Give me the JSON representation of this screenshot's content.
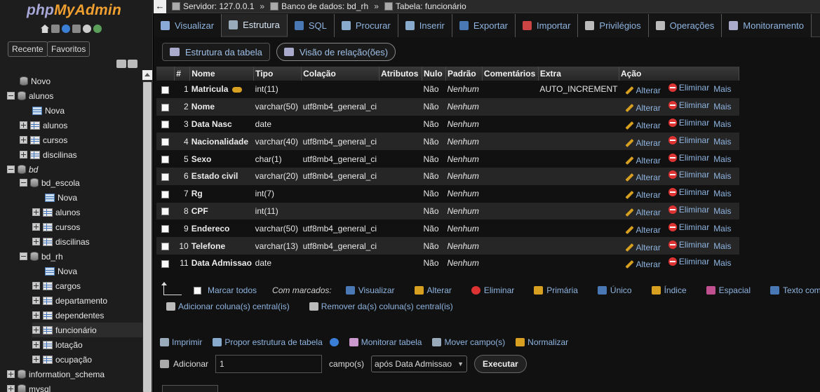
{
  "sidebar": {
    "logo_php": "php",
    "logo_myadmin": "MyAdmin",
    "recent_label": "Recente",
    "favorites_label": "Favoritos",
    "tree": [
      {
        "label": "Novo",
        "level": 0,
        "icon": "db-new"
      },
      {
        "label": "alunos",
        "level": 0,
        "icon": "db"
      },
      {
        "label": "Nova",
        "level": 1,
        "icon": "table-new"
      },
      {
        "label": "alunos",
        "level": 1,
        "icon": "table"
      },
      {
        "label": "cursos",
        "level": 1,
        "icon": "table"
      },
      {
        "label": "discilinas",
        "level": 1,
        "icon": "table"
      },
      {
        "label": "bd",
        "level": 0,
        "icon": "db"
      },
      {
        "label": "bd_escola",
        "level": 1,
        "icon": "db"
      },
      {
        "label": "Nova",
        "level": 2,
        "icon": "table-new"
      },
      {
        "label": "alunos",
        "level": 2,
        "icon": "table"
      },
      {
        "label": "cursos",
        "level": 2,
        "icon": "table"
      },
      {
        "label": "discilinas",
        "level": 2,
        "icon": "table"
      },
      {
        "label": "bd_rh",
        "level": 1,
        "icon": "db"
      },
      {
        "label": "Nova",
        "level": 2,
        "icon": "table-new"
      },
      {
        "label": "cargos",
        "level": 2,
        "icon": "table"
      },
      {
        "label": "departamento",
        "level": 2,
        "icon": "table"
      },
      {
        "label": "dependentes",
        "level": 2,
        "icon": "table"
      },
      {
        "label": "funcionário",
        "level": 2,
        "icon": "table"
      },
      {
        "label": "lotação",
        "level": 2,
        "icon": "table"
      },
      {
        "label": "ocupação",
        "level": 2,
        "icon": "table"
      },
      {
        "label": "information_schema",
        "level": 0,
        "icon": "db"
      },
      {
        "label": "mysql",
        "level": 0,
        "icon": "db"
      }
    ]
  },
  "breadcrumb": {
    "server": "Servidor: 127.0.0.1",
    "database": "Banco de dados: bd_rh",
    "table": "Tabela: funcionário",
    "separator": "»"
  },
  "tabs": [
    {
      "label": "Visualizar",
      "icon": "browse-icon"
    },
    {
      "label": "Estrutura",
      "icon": "structure-icon"
    },
    {
      "label": "SQL",
      "icon": "sql-icon"
    },
    {
      "label": "Procurar",
      "icon": "search-icon"
    },
    {
      "label": "Inserir",
      "icon": "insert-icon"
    },
    {
      "label": "Exportar",
      "icon": "export-icon"
    },
    {
      "label": "Importar",
      "icon": "import-icon"
    },
    {
      "label": "Privilégios",
      "icon": "privileges-icon"
    },
    {
      "label": "Operações",
      "icon": "operations-icon"
    },
    {
      "label": "Monitoramento",
      "icon": "tracking-icon"
    }
  ],
  "subtabs": {
    "structure": "Estrutura da tabela",
    "relations": "Visão de relação(ões)"
  },
  "table": {
    "headers": [
      "#",
      "Nome",
      "Tipo",
      "Colação",
      "Atributos",
      "Nulo",
      "Padrão",
      "Comentários",
      "Extra",
      "Ação"
    ],
    "rows": [
      {
        "num": "1",
        "name": "Matricula",
        "type": "int(11)",
        "collation": "",
        "attributes": "",
        "null": "Não",
        "default": "Nenhum",
        "comments": "",
        "extra": "AUTO_INCREMENT",
        "primary": true
      },
      {
        "num": "2",
        "name": "Nome",
        "type": "varchar(50)",
        "collation": "utf8mb4_general_ci",
        "attributes": "",
        "null": "Não",
        "default": "Nenhum",
        "comments": "",
        "extra": ""
      },
      {
        "num": "3",
        "name": "Data Nasc",
        "type": "date",
        "collation": "",
        "attributes": "",
        "null": "Não",
        "default": "Nenhum",
        "comments": "",
        "extra": ""
      },
      {
        "num": "4",
        "name": "Nacionalidade",
        "type": "varchar(40)",
        "collation": "utf8mb4_general_ci",
        "attributes": "",
        "null": "Não",
        "default": "Nenhum",
        "comments": "",
        "extra": ""
      },
      {
        "num": "5",
        "name": "Sexo",
        "type": "char(1)",
        "collation": "utf8mb4_general_ci",
        "attributes": "",
        "null": "Não",
        "default": "Nenhum",
        "comments": "",
        "extra": ""
      },
      {
        "num": "6",
        "name": "Estado civil",
        "type": "varchar(20)",
        "collation": "utf8mb4_general_ci",
        "attributes": "",
        "null": "Não",
        "default": "Nenhum",
        "comments": "",
        "extra": ""
      },
      {
        "num": "7",
        "name": "Rg",
        "type": "int(7)",
        "collation": "",
        "attributes": "",
        "null": "Não",
        "default": "Nenhum",
        "comments": "",
        "extra": ""
      },
      {
        "num": "8",
        "name": "CPF",
        "type": "int(11)",
        "collation": "",
        "attributes": "",
        "null": "Não",
        "default": "Nenhum",
        "comments": "",
        "extra": ""
      },
      {
        "num": "9",
        "name": "Endereco",
        "type": "varchar(50)",
        "collation": "utf8mb4_general_ci",
        "attributes": "",
        "null": "Não",
        "default": "Nenhum",
        "comments": "",
        "extra": ""
      },
      {
        "num": "10",
        "name": "Telefone",
        "type": "varchar(13)",
        "collation": "utf8mb4_general_ci",
        "attributes": "",
        "null": "Não",
        "default": "Nenhum",
        "comments": "",
        "extra": ""
      },
      {
        "num": "11",
        "name": "Data Admissao",
        "type": "date",
        "collation": "",
        "attributes": "",
        "null": "Não",
        "default": "Nenhum",
        "comments": "",
        "extra": ""
      }
    ],
    "action_change": "Alterar",
    "action_drop": "Eliminar",
    "action_more": "Mais"
  },
  "with_selected": {
    "check_all": "Marcar todos",
    "label": "Com marcados:",
    "items": [
      {
        "label": "Visualizar",
        "icon": "browse-icon",
        "color": "#4a78b5"
      },
      {
        "label": "Alterar",
        "icon": "pencil-icon",
        "color": "#d8a020"
      },
      {
        "label": "Eliminar",
        "icon": "delete-icon",
        "color": "#dd3333"
      },
      {
        "label": "Primária",
        "icon": "key-icon",
        "color": "#d8a020"
      },
      {
        "label": "Único",
        "icon": "unique-icon",
        "color": "#4a78b5"
      },
      {
        "label": "Índice",
        "icon": "index-icon",
        "color": "#d8a020"
      },
      {
        "label": "Espacial",
        "icon": "spatial-icon",
        "color": "#c05090"
      },
      {
        "label": "Texto completo",
        "icon": "fulltext-icon",
        "color": "#4a78b5"
      }
    ]
  },
  "central_columns": {
    "add": "Adicionar coluna(s) central(is)",
    "remove": "Remover da(s) coluna(s) central(is)"
  },
  "bottom_actions": [
    {
      "label": "Imprimir",
      "icon": "print-icon"
    },
    {
      "label": "Propor estrutura de tabela",
      "icon": "propose-icon"
    },
    {
      "label": "Monitorar tabela",
      "icon": "track-icon"
    },
    {
      "label": "Mover campo(s)",
      "icon": "move-icon"
    },
    {
      "label": "Normalizar",
      "icon": "normalize-icon"
    }
  ],
  "add_field": {
    "label": "Adicionar",
    "count": "1",
    "fields_label": "campo(s)",
    "position": "após Data Admissao",
    "execute": "Executar"
  },
  "colors": {
    "link": "#8fb4e0",
    "logo_orange": "#f0a030",
    "logo_php": "#a8a8d8",
    "background": "#111111"
  }
}
